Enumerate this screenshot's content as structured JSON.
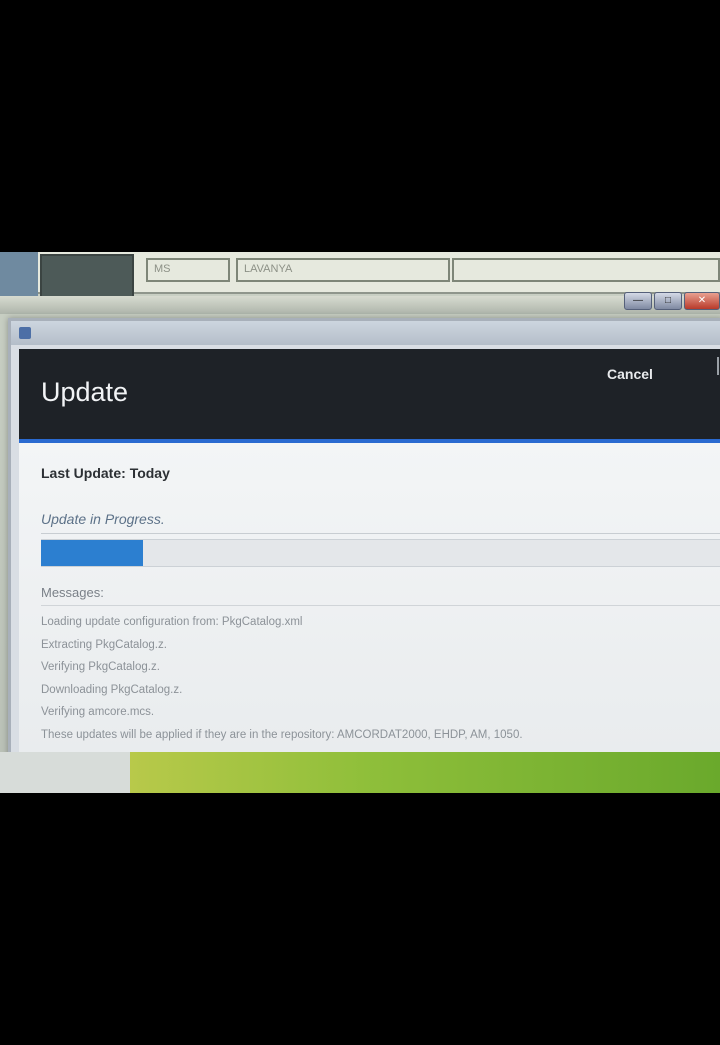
{
  "background": {
    "table_cells": [
      "MS",
      "LAVANYA"
    ]
  },
  "window_controls": {
    "minimize": "—",
    "maximize": "□",
    "close": "✕"
  },
  "dialog": {
    "title": "Update",
    "cancel_label": "Cancel",
    "last_update_label": "Last Update:",
    "last_update_value": "Today",
    "progress_label": "Update in Progress.",
    "progress_fraction": 0.15,
    "messages_label": "Messages:",
    "messages": [
      "Loading update configuration from: PkgCatalog.xml",
      "Extracting PkgCatalog.z.",
      "Verifying PkgCatalog.z.",
      "Downloading PkgCatalog.z.",
      "Verifying amcore.mcs.",
      "These updates will be applied if they are in the repository: AMCORDAT2000, EHDP, AM, 1050."
    ]
  },
  "colors": {
    "header_bg": "#1e2227",
    "accent": "#2a6ad0",
    "progress_fill": "#2c7fd0"
  }
}
